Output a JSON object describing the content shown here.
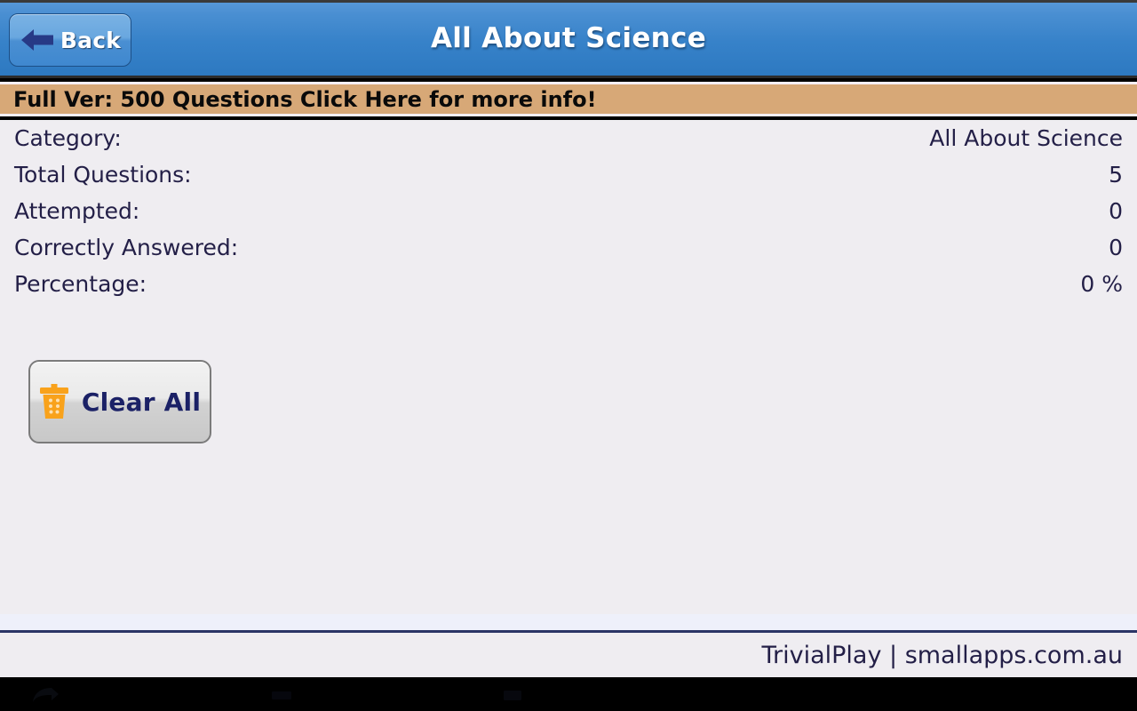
{
  "titlebar": {
    "back_label": "Back",
    "back_icon": "arrow-left-icon",
    "title": "All About Science"
  },
  "promo": {
    "text": "Full Ver: 500 Questions Click Here for more info!",
    "background_color": "#d7a877"
  },
  "stats": {
    "rows": [
      {
        "label": "Category:",
        "value": "All About Science"
      },
      {
        "label": "Total Questions:",
        "value": "5"
      },
      {
        "label": "Attempted:",
        "value": "0"
      },
      {
        "label": "Correctly Answered:",
        "value": "0"
      },
      {
        "label": "Percentage:",
        "value": "0 %"
      }
    ]
  },
  "actions": {
    "clear_label": "Clear All",
    "clear_icon": "trash-icon"
  },
  "footer": {
    "text": "TrivialPlay | smallapps.com.au"
  },
  "colors": {
    "header_blue": "#3782c9",
    "text_navy": "#231f47",
    "accent_orange": "#f9a21b",
    "page_background": "#efedf1"
  }
}
